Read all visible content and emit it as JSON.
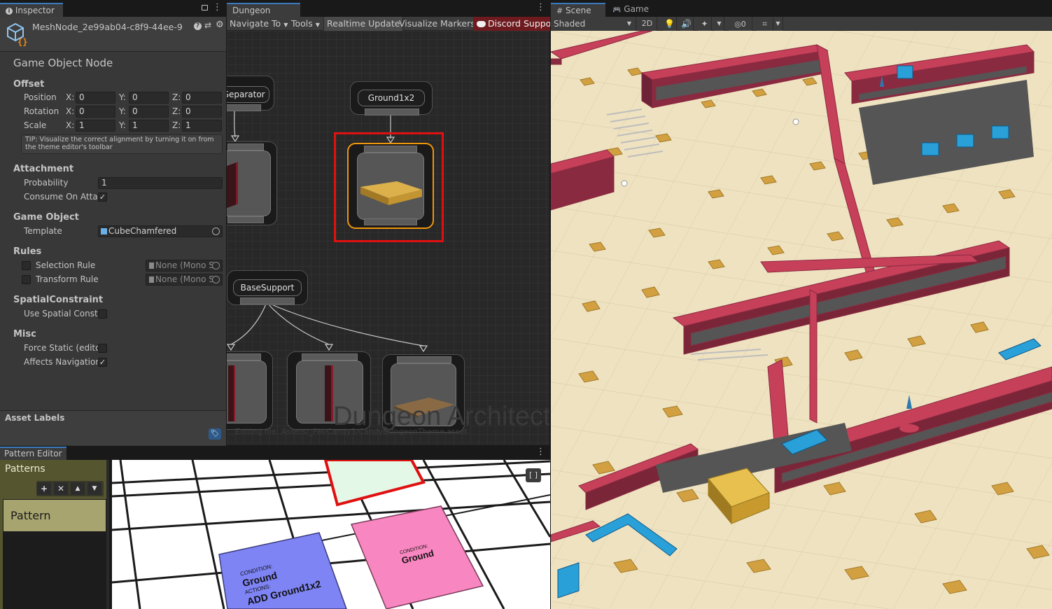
{
  "inspector": {
    "tab_label": "Inspector",
    "object_name": "MeshNode_2e99ab04-c8f9-44ee-9",
    "title": "Game Object Node",
    "offset": {
      "header": "Offset",
      "position_label": "Position",
      "rotation_label": "Rotation",
      "scale_label": "Scale",
      "x_label": "X:",
      "y_label": "Y:",
      "z_label": "Z:",
      "position": [
        "0",
        "0",
        "0"
      ],
      "rotation": [
        "0",
        "0",
        "0"
      ],
      "scale": [
        "1",
        "1",
        "1"
      ],
      "tip": "TIP: Visualize the correct alignment by turning it on from the theme editor's toolbar"
    },
    "attachment": {
      "header": "Attachment",
      "probability_label": "Probability",
      "probability_value": "1",
      "consume_label": "Consume On Attac",
      "consume_checked": true
    },
    "game_object": {
      "header": "Game Object",
      "template_label": "Template",
      "template_value": "CubeChamfered"
    },
    "rules": {
      "header": "Rules",
      "selection_label": "Selection Rule",
      "selection_value": "None (Mono S",
      "transform_label": "Transform Rule",
      "transform_value": "None (Mono S"
    },
    "spatial": {
      "header": "SpatialConstraint",
      "use_label": "Use Spatial Constr"
    },
    "misc": {
      "header": "Misc",
      "force_static_label": "Force Static (edito",
      "affects_nav_label": "Affects Navigation",
      "affects_nav_checked": true
    },
    "asset_labels": "Asset Labels"
  },
  "theme_editor": {
    "tab_label": "Dungeon Theme",
    "toolbar": {
      "navigate": "Navigate To",
      "tools": "Tools",
      "realtime": "Realtime Update",
      "visualize": "Visualize Markers",
      "discord": "Discord Suppor"
    },
    "nodes": {
      "separator": "Separator",
      "ground": "Ground1x2",
      "base_support": "BaseSupport"
    },
    "watermark": "Dungeon Architect",
    "editing_file": "Editing file: Assets/_PM/Candy3/CandyDungeonTheme.asset"
  },
  "scene": {
    "scene_tab": "Scene",
    "game_tab": "Game",
    "shading": "Shaded",
    "mode_2d": "2D",
    "hidden_count": "0"
  },
  "pattern_editor": {
    "tab_label": "Pattern Editor",
    "patterns_header": "Patterns",
    "pattern_item": "Pattern",
    "blue_tile": {
      "condition_label": "CONDITION:",
      "condition": "Ground",
      "actions_label": "ACTIONS:",
      "action": "ADD Ground1x2"
    },
    "pink_tile": {
      "condition_label": "CONDITION:",
      "condition": "Ground"
    }
  },
  "colors": {
    "panel": "#383838",
    "graph": "#282828",
    "selection_red": "#e01010",
    "selection_orange": "#f0960a",
    "dungeon_pink": "#c6405a",
    "floor": "#efe2c0",
    "tile_gold": "#d2a040",
    "pattern_olive": "#a8a470"
  }
}
